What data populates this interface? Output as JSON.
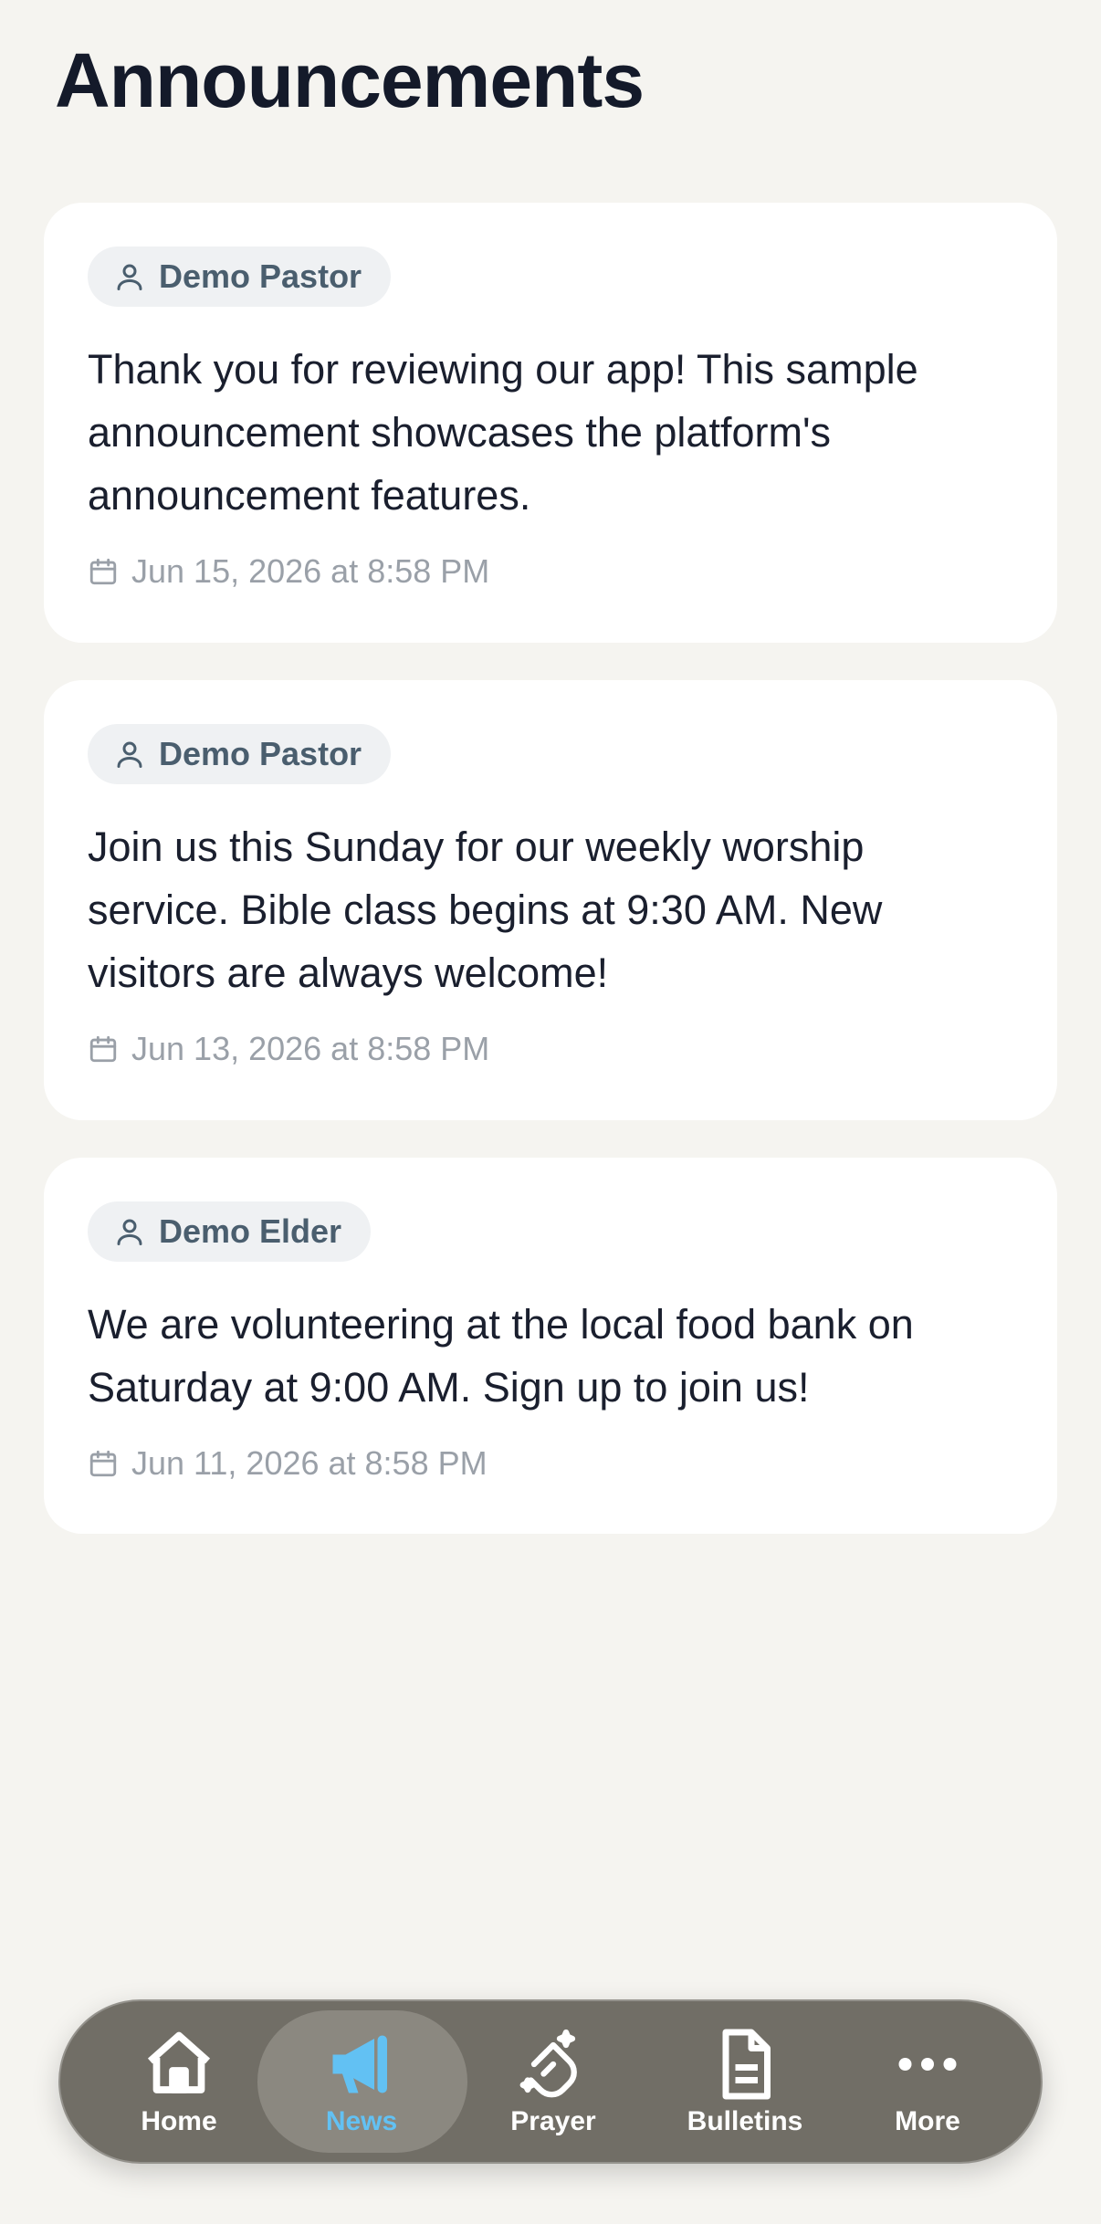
{
  "header": {
    "title": "Announcements"
  },
  "announcements": [
    {
      "author": "Demo Pastor",
      "body": "Thank you for reviewing our app! This sample announcement showcases the platform's announcement features.",
      "date": "Jun 15, 2026 at 8:58 PM"
    },
    {
      "author": "Demo Pastor",
      "body": "Join us this Sunday for our weekly worship service. Bible class begins at 9:30 AM. New visitors are always welcome!",
      "date": "Jun 13, 2026 at 8:58 PM"
    },
    {
      "author": "Demo Elder",
      "body": "We are volunteering at the local food bank on Saturday at 9:00 AM. Sign up to join us!",
      "date": "Jun 11, 2026 at 8:58 PM"
    }
  ],
  "tabbar": {
    "active": "News",
    "tabs": [
      {
        "label": "Home",
        "icon": "home-icon"
      },
      {
        "label": "News",
        "icon": "megaphone-icon"
      },
      {
        "label": "Prayer",
        "icon": "praying-hands-icon"
      },
      {
        "label": "Bulletins",
        "icon": "document-icon"
      },
      {
        "label": "More",
        "icon": "more-dots-icon"
      }
    ]
  },
  "colors": {
    "background": "#f5f4f0",
    "card": "#ffffff",
    "tabbar": "#716e66",
    "active_tab": "#62c1f3",
    "chip_bg": "#eff1f3",
    "chip_text": "#4a5e6e",
    "date_text": "#9aa0a8"
  }
}
